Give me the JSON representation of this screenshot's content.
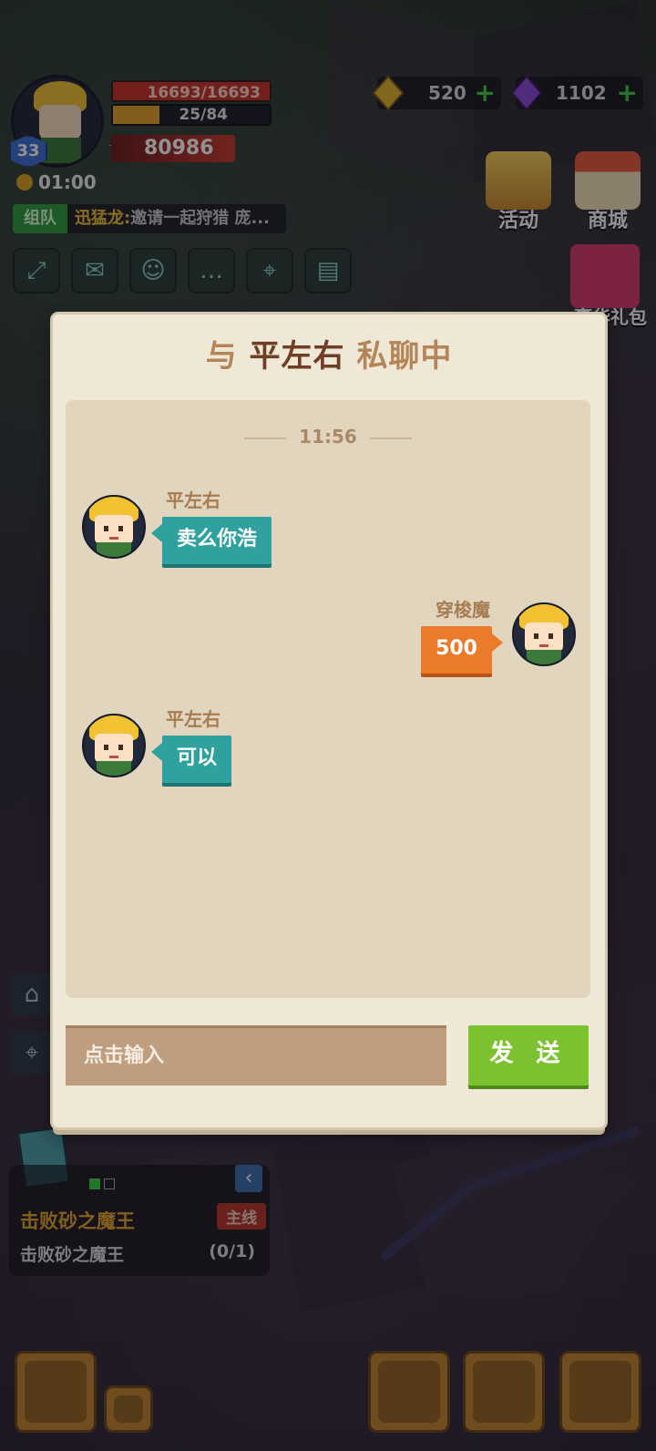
{
  "player": {
    "level": "33",
    "hp": "16693/16693",
    "energy": "25/84",
    "energy_progress": 0.2976,
    "power": "80986",
    "timer": "01:00"
  },
  "currency": {
    "gold": "520",
    "gems": "1102"
  },
  "team_chat": {
    "tag": "组队",
    "sender": "迅猛龙:",
    "text": "邀请一起狩猎 庞..."
  },
  "top_buttons": {
    "events_label": "活动",
    "store_label": "商城",
    "gift_label": "豪华礼包"
  },
  "icons": [
    {
      "name": "expand-icon",
      "glyph": "⤢"
    },
    {
      "name": "mail-icon",
      "glyph": "✉"
    },
    {
      "name": "friends-icon",
      "glyph": "☺"
    },
    {
      "name": "chat-icon",
      "glyph": "…"
    },
    {
      "name": "map-icon",
      "glyph": "⌖"
    },
    {
      "name": "notice-icon",
      "glyph": "▤"
    }
  ],
  "dialog": {
    "title_prefix": "与",
    "partner_name": "平左右",
    "title_suffix": "私聊中",
    "timestamp": "11:56",
    "messages": [
      {
        "side": "left",
        "sender": "平左右",
        "text": "卖么你浩",
        "color": "#2fa2a0"
      },
      {
        "side": "right",
        "sender": "穿梭魔",
        "text": "500",
        "color": "#ea7b2a"
      },
      {
        "side": "left",
        "sender": "平左右",
        "text": "可以",
        "color": "#2fa2a0"
      }
    ],
    "input_placeholder": "点击输入",
    "send_label": "发 送"
  },
  "quest": {
    "title": "击败砂之魔王",
    "tag": "主线",
    "description": "击败砂之魔王",
    "progress": "(0/1)"
  },
  "colors": {
    "accent_teal": "#2fa2a0",
    "accent_orange": "#ea7b2a",
    "send_green": "#7cc230"
  }
}
